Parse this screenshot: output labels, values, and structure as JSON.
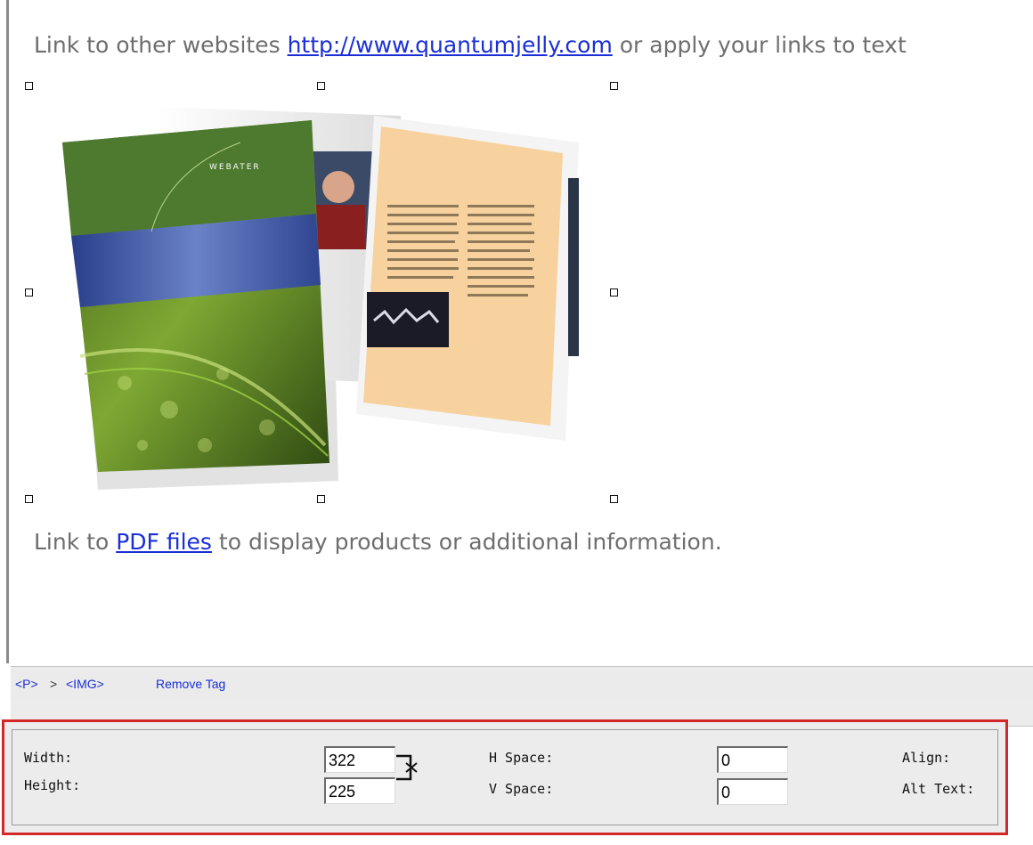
{
  "editor": {
    "line1_prefix": "Link to other websites ",
    "line1_link": "http://www.quantumjelly.com",
    "line1_suffix": " or apply your links to text",
    "line2_prefix": "Link to ",
    "line2_link": "PDF files",
    "line2_suffix": " to display products or additional information.",
    "image_cover_text": "WEBATER"
  },
  "tag_path": {
    "p_tag": "<P>",
    "separator": ">",
    "img_tag": "<IMG>",
    "remove_label": "Remove Tag"
  },
  "image_properties": {
    "width_label": "Width:",
    "width_value": "322",
    "height_label": "Height:",
    "height_value": "225",
    "hspace_label": "H Space:",
    "hspace_value": "0",
    "vspace_label": "V Space:",
    "vspace_value": "0",
    "align_label": "Align:",
    "alt_label": "Alt Text:"
  },
  "colors": {
    "link": "#1a2fd6",
    "highlight_border": "#d42828",
    "body_text": "#6e6e6e"
  }
}
